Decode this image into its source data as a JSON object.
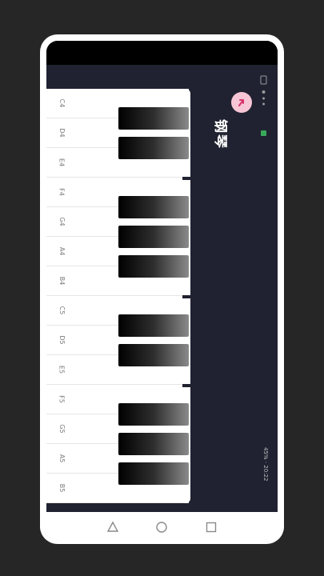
{
  "app": {
    "title": "钢琴"
  },
  "status_bar": {
    "time": "20:22",
    "battery": "45%"
  },
  "piano": {
    "white_keys": [
      "C4",
      "D4",
      "E4",
      "F4",
      "G4",
      "A4",
      "B4",
      "C5",
      "D5",
      "E5",
      "F5",
      "G5",
      "A5",
      "B5"
    ],
    "black_keys": [
      "C#4",
      "D#4",
      "F#4",
      "G#4",
      "A#4",
      "C#5",
      "D#5",
      "F#5",
      "G#5",
      "A#5"
    ]
  },
  "nav": {
    "back_icon": "triangle-back-icon",
    "home_icon": "circle-home-icon",
    "recents_icon": "square-recents-icon"
  },
  "colors": {
    "background": "#202231",
    "accent": "#f7c6d6",
    "key_white": "#ffffff"
  }
}
